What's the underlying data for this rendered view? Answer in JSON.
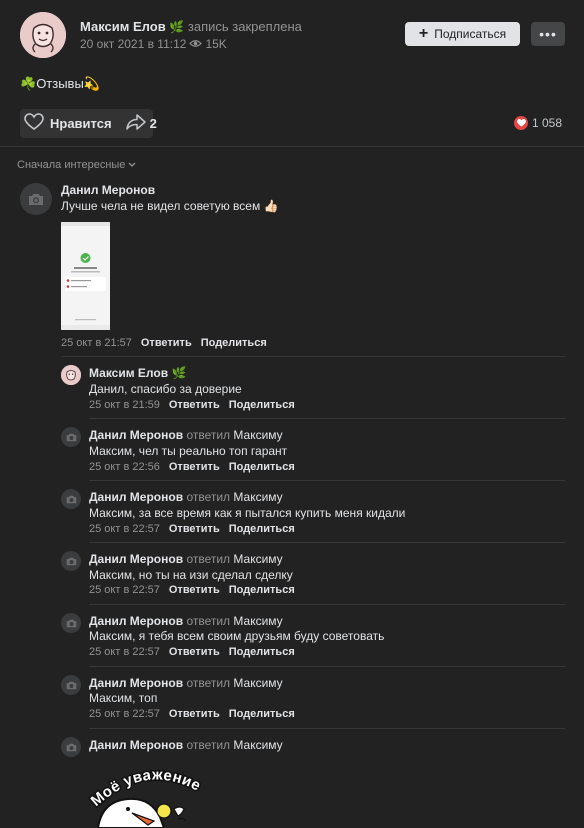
{
  "post": {
    "author": "Максим Елов",
    "author_badge": "🌿",
    "pinned_label": "запись закреплена",
    "date": "20 окт 2021 в 11:12",
    "views": "15K",
    "subscribe_label": "Подписаться",
    "more_label": "•••",
    "text_emoji_start": "☘️",
    "text": "Отзывы",
    "text_emoji_end": "💫",
    "like_label": "Нравится",
    "share_count": "2",
    "reactions_count": "1 058"
  },
  "sort_label": "Сначала интересные",
  "actions": {
    "reply": "Ответить",
    "share": "Поделиться"
  },
  "comments": [
    {
      "author": "Данил Меронов",
      "text": "Лучше чела не видел советую всем 👍🏻",
      "date": "25 окт в 21:57"
    },
    {
      "author": "Максим Елов",
      "badge": "🌿",
      "text": "Данил, спасибо за доверие",
      "date": "25 окт в 21:59"
    },
    {
      "author": "Данил Меронов",
      "replied": "ответил",
      "to": "Максиму",
      "text": "Максим, чел ты реально топ гарант",
      "date": "25 окт в 22:56"
    },
    {
      "author": "Данил Меронов",
      "replied": "ответил",
      "to": "Максиму",
      "text": "Максим, за все время как я пытался купить меня кидали",
      "date": "25 окт в 22:57"
    },
    {
      "author": "Данил Меронов",
      "replied": "ответил",
      "to": "Максиму",
      "text": "Максим, но ты на изи сделал сделку",
      "date": "25 окт в 22:57"
    },
    {
      "author": "Данил Меронов",
      "replied": "ответил",
      "to": "Максиму",
      "text": "Максим, я тебя всем своим друзьям буду советовать",
      "date": "25 окт в 22:57"
    },
    {
      "author": "Данил Меронов",
      "replied": "ответил",
      "to": "Максиму",
      "text": "Максим, топ",
      "date": "25 окт в 22:57"
    },
    {
      "author": "Данил Меронов",
      "replied": "ответил",
      "to": "Максиму",
      "sticker_text": "Моё уважение"
    }
  ],
  "colors": {
    "background": "#222222",
    "accent": "#e64646",
    "muted": "#939393",
    "text": "#e1e3e6"
  }
}
